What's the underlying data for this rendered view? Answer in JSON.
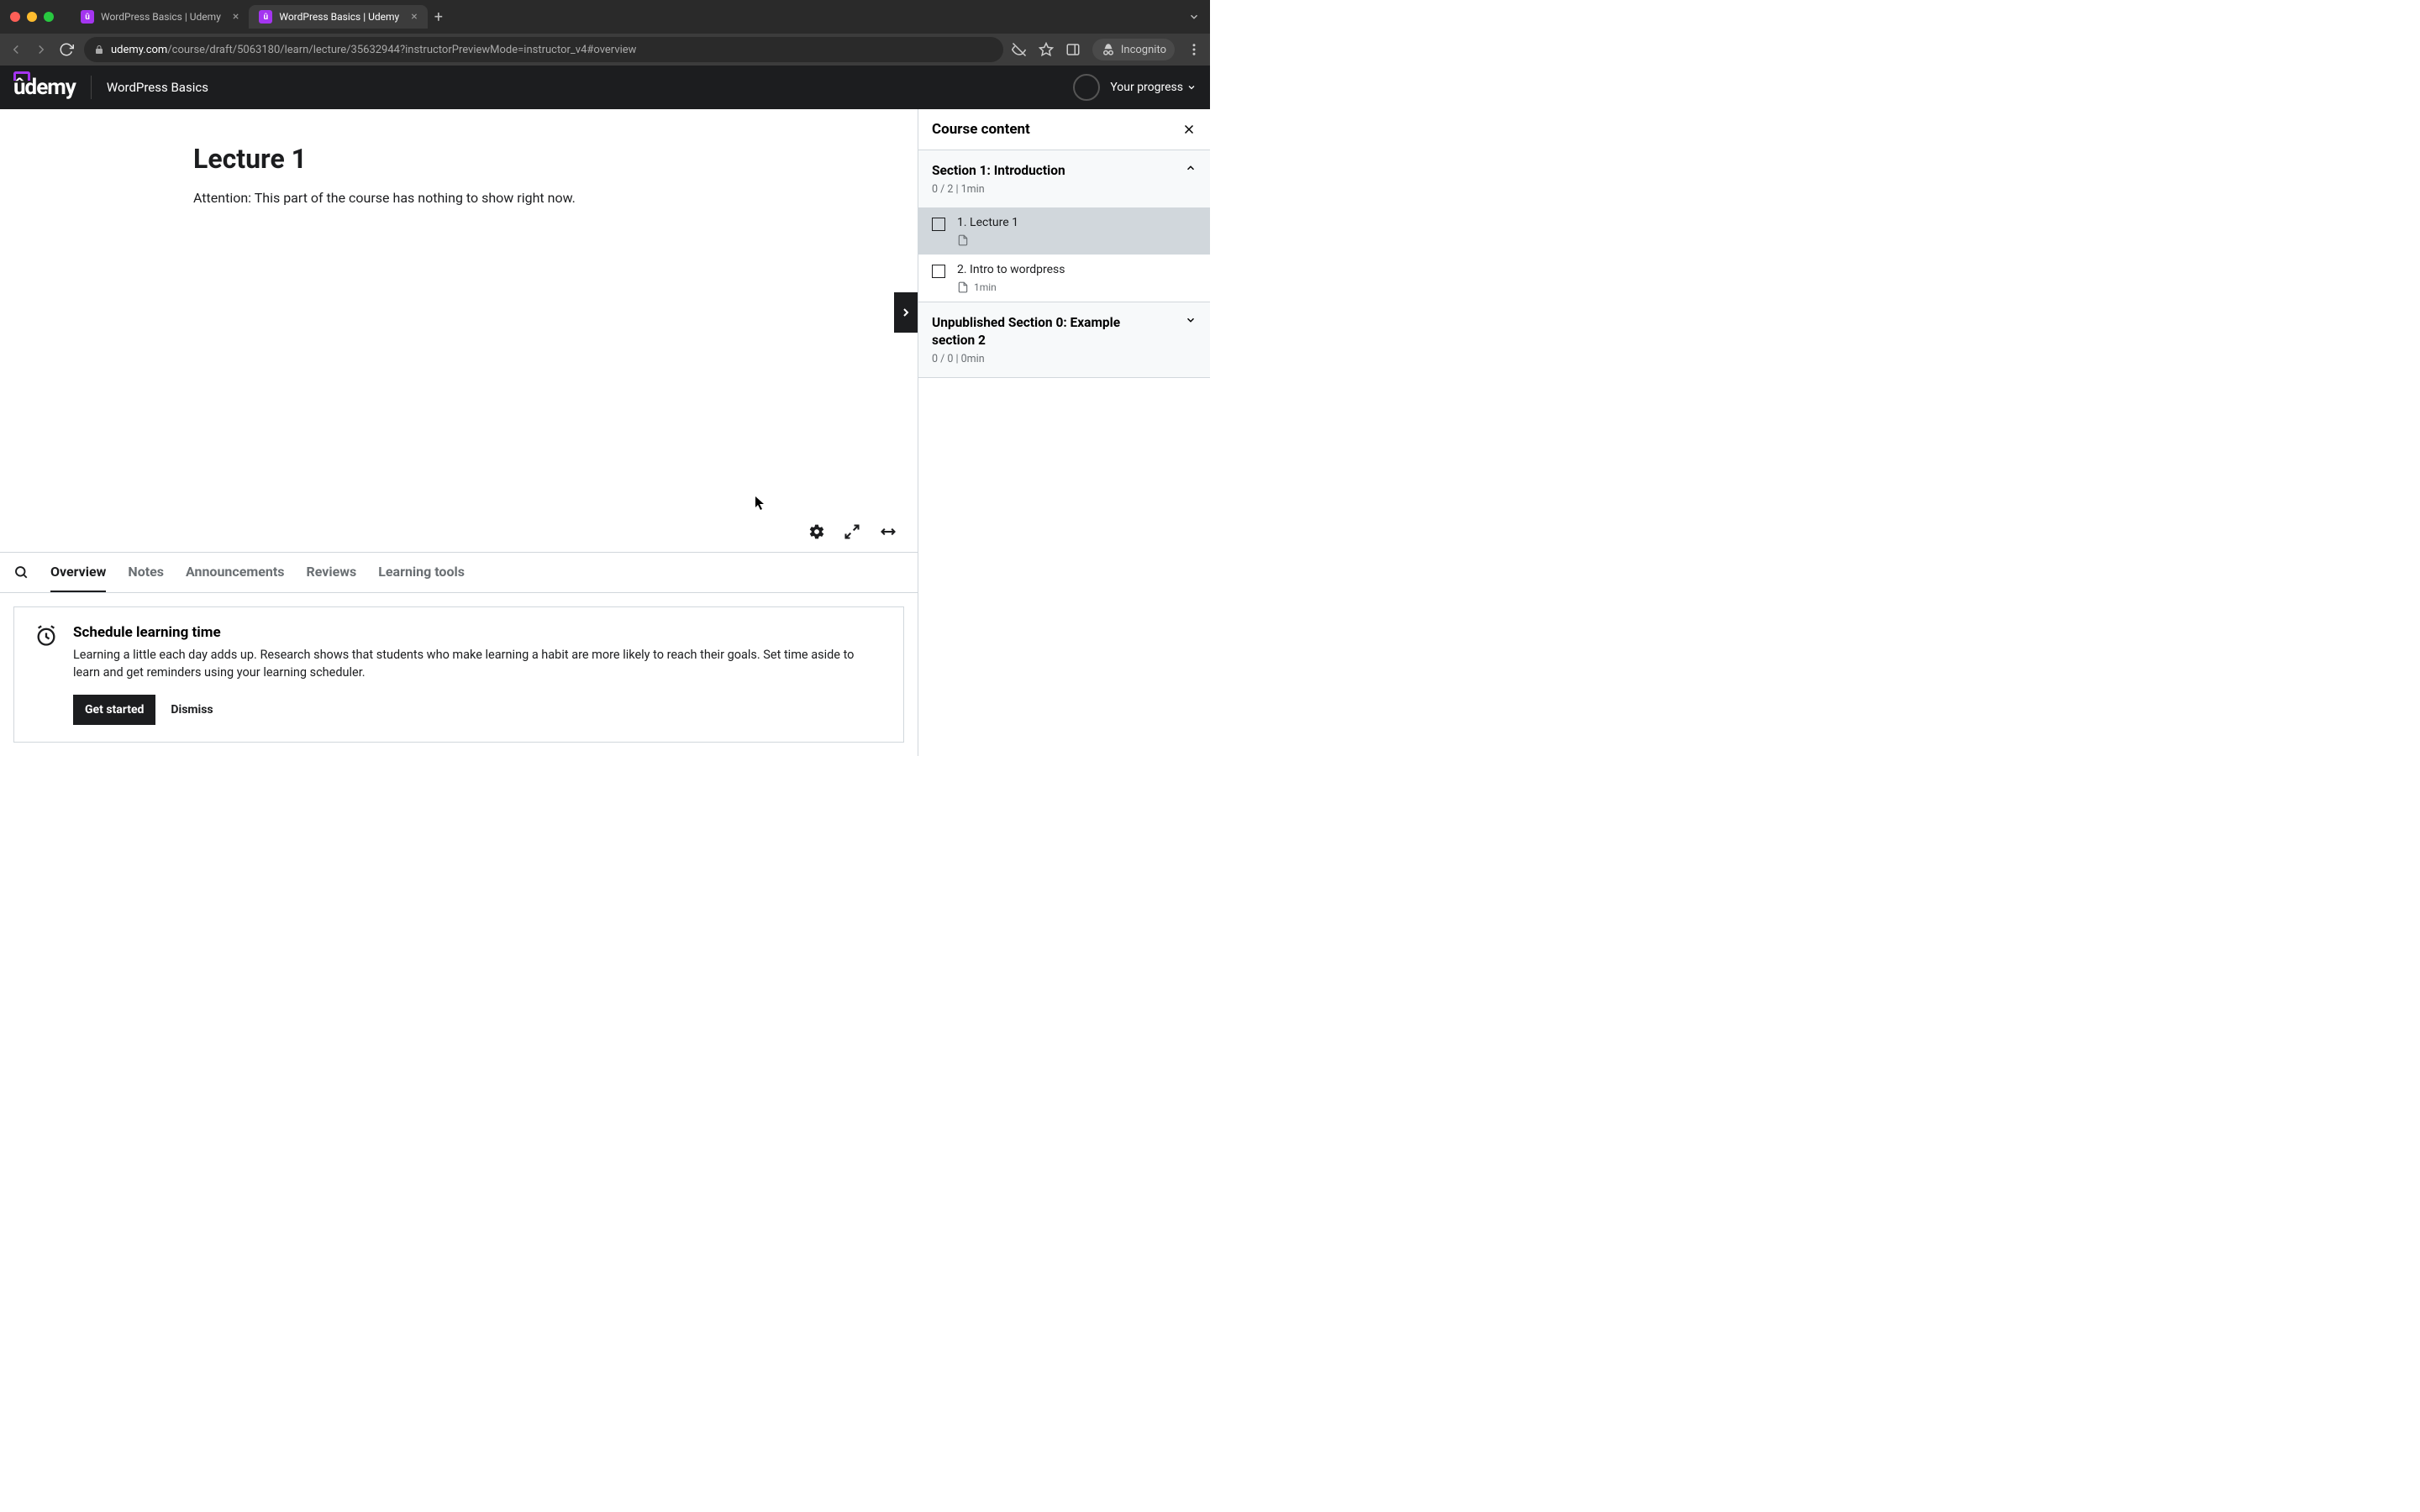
{
  "browser": {
    "tabs": [
      {
        "title": "WordPress Basics | Udemy",
        "active": false
      },
      {
        "title": "WordPress Basics | Udemy",
        "active": true
      }
    ],
    "url_host": "udemy.com",
    "url_path": "/course/draft/5063180/learn/lecture/35632944?instructorPreviewMode=instructor_v4#overview",
    "incognito_label": "Incognito"
  },
  "header": {
    "logo_text": "ûdemy",
    "course_title": "WordPress Basics",
    "progress_label": "Your progress"
  },
  "lecture": {
    "title": "Lecture 1",
    "body": "Attention: This part of the course has nothing to show right now."
  },
  "tabs": {
    "items": [
      "Overview",
      "Notes",
      "Announcements",
      "Reviews",
      "Learning tools"
    ],
    "active": 0
  },
  "schedule": {
    "title": "Schedule learning time",
    "body": "Learning a little each day adds up. Research shows that students who make learning a habit are more likely to reach their goals. Set time aside to learn and get reminders using your learning scheduler.",
    "primary": "Get started",
    "dismiss": "Dismiss"
  },
  "sidebar": {
    "title": "Course content",
    "sections": [
      {
        "name": "Section 1: Introduction",
        "meta": "0 / 2 | 1min",
        "expanded": true,
        "lectures": [
          {
            "name": "1. Lecture 1",
            "meta": "",
            "active": true
          },
          {
            "name": "2. Intro to wordpress",
            "meta": "1min",
            "active": false
          }
        ]
      },
      {
        "name": "Unpublished Section 0: Example section 2",
        "meta": "0 / 0 | 0min",
        "expanded": false,
        "lectures": []
      }
    ]
  }
}
